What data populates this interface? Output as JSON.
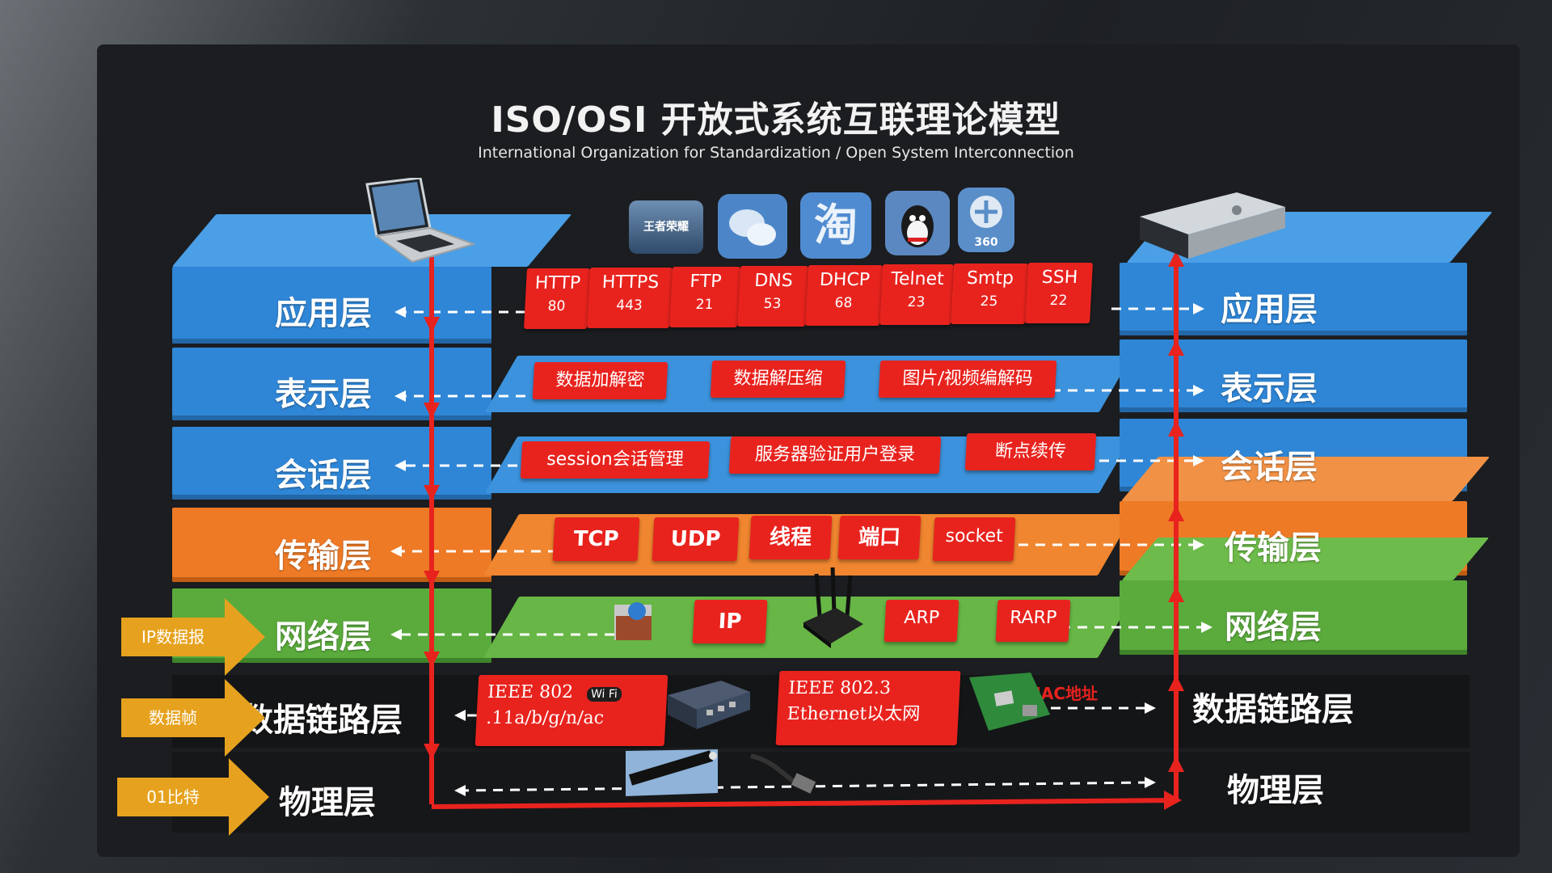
{
  "title": "ISO/OSI 开放式系统互联理论模型",
  "subtitle": "International Organization for Standardization / Open System Interconnection",
  "layers": {
    "application": "应用层",
    "presentation": "表示层",
    "session": "会话层",
    "transport": "传输层",
    "network": "网络层",
    "datalink": "数据链路层",
    "physical": "物理层"
  },
  "units": {
    "ip_packet": "IP数据报",
    "frame": "数据帧",
    "bits": "01比特"
  },
  "application_protocols": [
    {
      "name": "HTTP",
      "port": "80"
    },
    {
      "name": "HTTPS",
      "port": "443"
    },
    {
      "name": "FTP",
      "port": "21"
    },
    {
      "name": "DNS",
      "port": "53"
    },
    {
      "name": "DHCP",
      "port": "68"
    },
    {
      "name": "Telnet",
      "port": "23"
    },
    {
      "name": "Smtp",
      "port": "25"
    },
    {
      "name": "SSH",
      "port": "22"
    }
  ],
  "presentation_items": [
    "数据加解密",
    "数据解压缩",
    "图片/视频编解码"
  ],
  "session_items": [
    "session会话管理",
    "服务器验证用户登录",
    "断点续传"
  ],
  "transport_items": [
    "TCP",
    "UDP",
    "线程",
    "端口",
    "socket"
  ],
  "network_items": [
    "IP",
    "ARP",
    "RARP"
  ],
  "datalink": {
    "wifi_line1": "IEEE 802",
    "wifi_badge": "Wi Fi",
    "wifi_line2": ".11a/b/g/n/ac",
    "eth_line1": "IEEE 802.3",
    "eth_line2": "Ethernet以太网",
    "mac": "MAC地址"
  },
  "app_icons": [
    "王者荣耀",
    "微信",
    "淘",
    "QQ",
    "360"
  ],
  "colors": {
    "app": "#2f86d6",
    "transport": "#ee7a26",
    "network": "#5aab3c",
    "tag": "#e8231e",
    "arrow": "#e6a21e",
    "dark": "#141517"
  }
}
